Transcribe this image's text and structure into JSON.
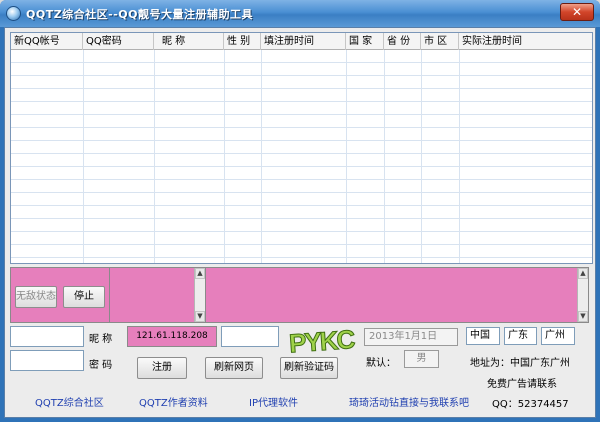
{
  "window": {
    "title": "QQTZ综合社区--QQ靓号大量注册辅助工具",
    "close_glyph": "✕"
  },
  "table": {
    "columns": [
      "新QQ帐号",
      "QQ密码",
      "昵  称",
      "性  别",
      "填注册时间",
      "国  家",
      "省  份",
      "市  区",
      "实际注册时间"
    ]
  },
  "log": {
    "invincible_label": "无敌状态",
    "stop_label": "停止"
  },
  "form": {
    "nickname_label": "昵  称",
    "password_label": "密  码",
    "ip_value": "121.61.118.208",
    "register_label": "注册",
    "refresh_page_label": "刷新网页",
    "refresh_captcha_label": "刷新验证码",
    "date_value": "2013年1月1日",
    "default_label": "默认：",
    "sex_value": "男",
    "country_value": "中国",
    "province_value": "广东",
    "city_value": "广州",
    "address_text": "地址为：中国广东广州",
    "ad_text": "免费广告请联系",
    "qq_text": "QQ：52374457",
    "logo_text": "PYKC"
  },
  "links": {
    "community": "QQTZ综合社区",
    "author": "QQTZ作者资料",
    "proxy": "IP代理软件",
    "contact": "琦琦活动钻直接与我联系吧"
  },
  "colors": {
    "titlebar": "#4a8fd3",
    "pink": "#e67fbc",
    "link": "#1f3fb0"
  }
}
